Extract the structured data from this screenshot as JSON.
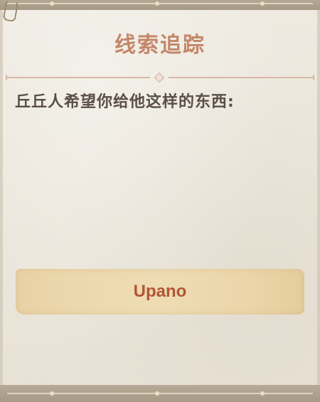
{
  "title": "线索追踪",
  "prompt": "丘丘人希望你给他这样的东西:",
  "answer": "Upano",
  "colors": {
    "title": "#c4876a",
    "prompt": "#5a4f46",
    "answer_text": "#b25534",
    "banner": "#ebd6aa",
    "background": "#ece7dc",
    "border": "#a69a86"
  },
  "icons": {
    "paperclip": "paperclip-icon",
    "divider": "diamond-divider-icon"
  }
}
